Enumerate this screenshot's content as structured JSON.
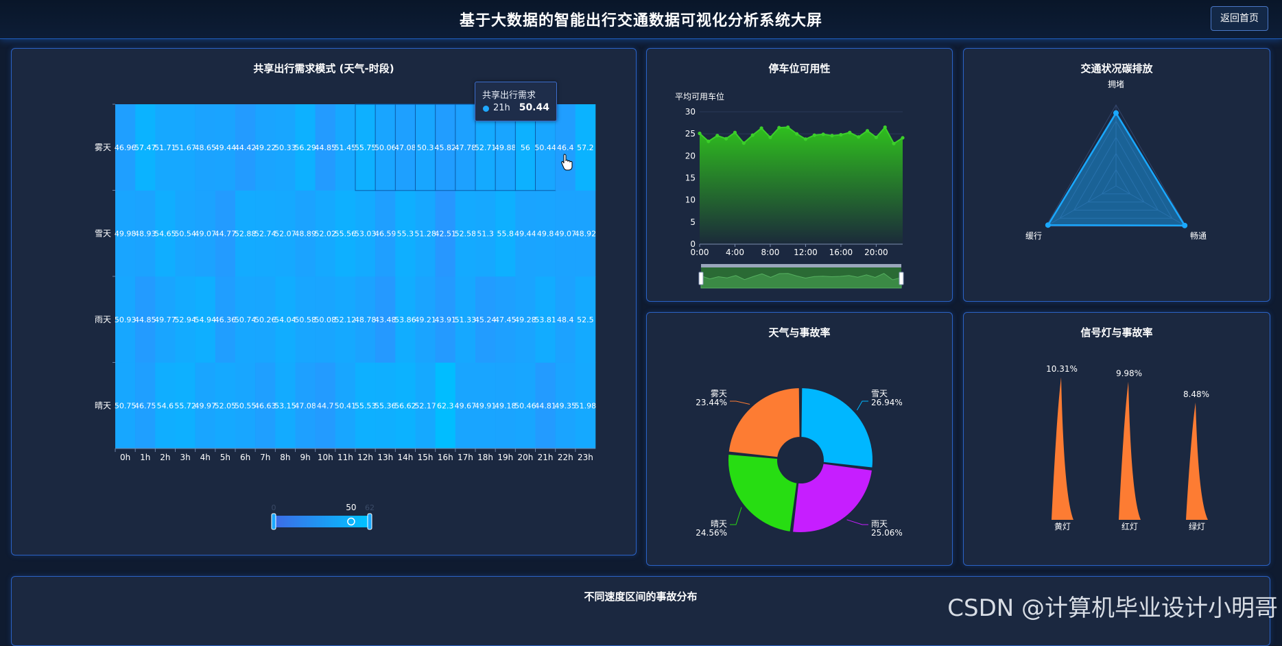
{
  "header": {
    "title": "基于大数据的智能出行交通数据可视化分析系统大屏",
    "back_button": "返回首页"
  },
  "colors": {
    "accent": "#1f5fc0",
    "heat_base": "#00b4ff",
    "parking_line": "#3ccf2a",
    "radar": "#1aa8ff"
  },
  "heatmap": {
    "title": "共享出行需求模式 (天气-时段)",
    "tooltip": {
      "series": "共享出行需求",
      "label": "21h",
      "value": "50.44"
    },
    "visualmap": {
      "min": "0",
      "max": "62",
      "handle_value": "50"
    }
  },
  "parking": {
    "title": "停车位可用性"
  },
  "radar": {
    "title": "交通状况碳排放"
  },
  "weather_accident": {
    "title": "天气与事故率"
  },
  "signal_accident": {
    "title": "信号灯与事故率"
  },
  "speed_accident": {
    "title": "不同速度区间的事故分布"
  },
  "watermark": "CSDN @计算机毕业设计小明哥",
  "chart_data": [
    {
      "type": "heatmap",
      "title": "共享出行需求模式 (天气-时段)",
      "x": [
        "0h",
        "1h",
        "2h",
        "3h",
        "4h",
        "5h",
        "6h",
        "7h",
        "8h",
        "9h",
        "10h",
        "11h",
        "12h",
        "13h",
        "14h",
        "15h",
        "16h",
        "17h",
        "18h",
        "19h",
        "20h",
        "21h",
        "22h",
        "23h"
      ],
      "y": [
        "晴天",
        "雨天",
        "雪天",
        "雾天"
      ],
      "values": [
        [
          50.75,
          46.75,
          54.6,
          55.72,
          49.97,
          52.05,
          50.55,
          46.63,
          53.15,
          47.08,
          44.7,
          50.41,
          55.53,
          55.36,
          56.62,
          52.17,
          62.3,
          49.67,
          49.91,
          49.18,
          50.46,
          44.81,
          49.35,
          51.98
        ],
        [
          50.93,
          44.85,
          49.77,
          52.94,
          54.94,
          46.36,
          50.74,
          50.26,
          54.04,
          50.58,
          50.08,
          52.12,
          48.78,
          43.48,
          53.86,
          49.21,
          43.91,
          51.33,
          45.24,
          47.45,
          49.28,
          53.81,
          48.4,
          52.5
        ],
        [
          49.98,
          48.93,
          54.65,
          50.54,
          49.07,
          44.77,
          52.88,
          52.74,
          52.07,
          48.89,
          52.02,
          55.56,
          53.03,
          46.59,
          55.3,
          51.28,
          42.51,
          52.58,
          51.3,
          55.8,
          49.44,
          49.8,
          49.07,
          48.92
        ],
        [
          46.96,
          57.47,
          51.71,
          51.67,
          48.65,
          49.44,
          44.42,
          49.22,
          50.33,
          56.29,
          44.85,
          51.45,
          55.75,
          50.06,
          47.08,
          50.3,
          45.82,
          47.78,
          52.71,
          49.88,
          56,
          50.44,
          46.4,
          57.2
        ]
      ],
      "display_texts": [
        [
          "50.75",
          "46.75",
          "54.6",
          "55.72",
          "49.97",
          "52.05",
          "50.55",
          "46.63",
          "53.15",
          "47.08",
          "44.7",
          "50.41",
          "55.53",
          "55.36",
          "56.62",
          "52.17",
          "62.3",
          "49.67",
          "49.91",
          "49.18",
          "50.46",
          "44.81",
          "49.35",
          "51.98"
        ],
        [
          "50.93",
          "44.85",
          "49.77",
          "52.94",
          "54.94",
          "46.36",
          "50.74",
          "50.26",
          "54.04",
          "50.58",
          "50.08",
          "52.12",
          "48.78",
          "43.48",
          "53.86",
          "49.21",
          "43.91",
          "51.33",
          "45.24",
          "47.45",
          "49.28",
          "53.81",
          "48.4",
          "52.5"
        ],
        [
          "49.98",
          "48.93",
          "54.65",
          "50.54",
          "49.07",
          "44.77",
          "52.88",
          "52.74",
          "52.07",
          "48.89",
          "52.02",
          "55.56",
          "53.03",
          "46.59",
          "55.3",
          "51.28",
          "42.51",
          "52.58",
          "51.3",
          "55.8",
          "49.44",
          "49.8",
          "49.07",
          "48.92"
        ],
        [
          "46.96",
          "57.47",
          "51.71",
          "51.67",
          "48.65",
          "49.44",
          "44.42",
          "49.22",
          "50.33",
          "56.29",
          "44.85",
          "51.45",
          "55.75",
          "50.06",
          "47.08",
          "50.3",
          "45.82",
          "47.78",
          "52.71",
          "49.88",
          "56",
          "50.44",
          "46.4",
          "57.2"
        ]
      ],
      "highlighted_cells": {
        "row": "雾天",
        "from": "12h",
        "to": "21h"
      },
      "visualmap_range": [
        0,
        62
      ]
    },
    {
      "type": "area",
      "title": "停车位可用性",
      "ylabel": "平均可用车位",
      "ylim": [
        0,
        30
      ],
      "yticks": [
        "0",
        "5",
        "10",
        "15",
        "20",
        "25",
        "30"
      ],
      "xticks": [
        "0:00",
        "4:00",
        "8:00",
        "12:00",
        "16:00",
        "20:00"
      ],
      "x": [
        0,
        1,
        2,
        3,
        4,
        5,
        6,
        7,
        8,
        9,
        10,
        11,
        12,
        13,
        14,
        15,
        16,
        17,
        18,
        19,
        20,
        21,
        22,
        23
      ],
      "values": [
        25.1,
        23.3,
        24.6,
        23.9,
        25.3,
        22.9,
        24.7,
        26.3,
        24.2,
        26.4,
        26.5,
        25.0,
        23.8,
        24.7,
        24.9,
        24.6,
        24.8,
        25.3,
        24.3,
        25.7,
        24.2,
        26.5,
        22.8,
        24.1
      ],
      "data_zoom": true
    },
    {
      "type": "radar",
      "title": "交通状况碳排放",
      "indicators": [
        "拥堵",
        "畅通",
        "缓行"
      ],
      "values": [
        0.9,
        0.98,
        0.97
      ]
    },
    {
      "type": "pie",
      "title": "天气与事故率",
      "slices": [
        {
          "name": "雪天",
          "value": 26.94,
          "label": "26.94%",
          "color": "#00b7ff"
        },
        {
          "name": "雨天",
          "value": 25.06,
          "label": "25.06%",
          "color": "#c61eff"
        },
        {
          "name": "晴天",
          "value": 24.56,
          "label": "24.56%",
          "color": "#27dd12"
        },
        {
          "name": "雾天",
          "value": 23.44,
          "label": "23.44%",
          "color": "#fd7c33"
        }
      ]
    },
    {
      "type": "bar",
      "title": "信号灯与事故率",
      "categories": [
        "黄灯",
        "红灯",
        "绿灯"
      ],
      "values": [
        10.31,
        9.98,
        8.48
      ],
      "labels": [
        "10.31%",
        "9.98%",
        "8.48%"
      ],
      "color": "#fd7c33"
    }
  ]
}
